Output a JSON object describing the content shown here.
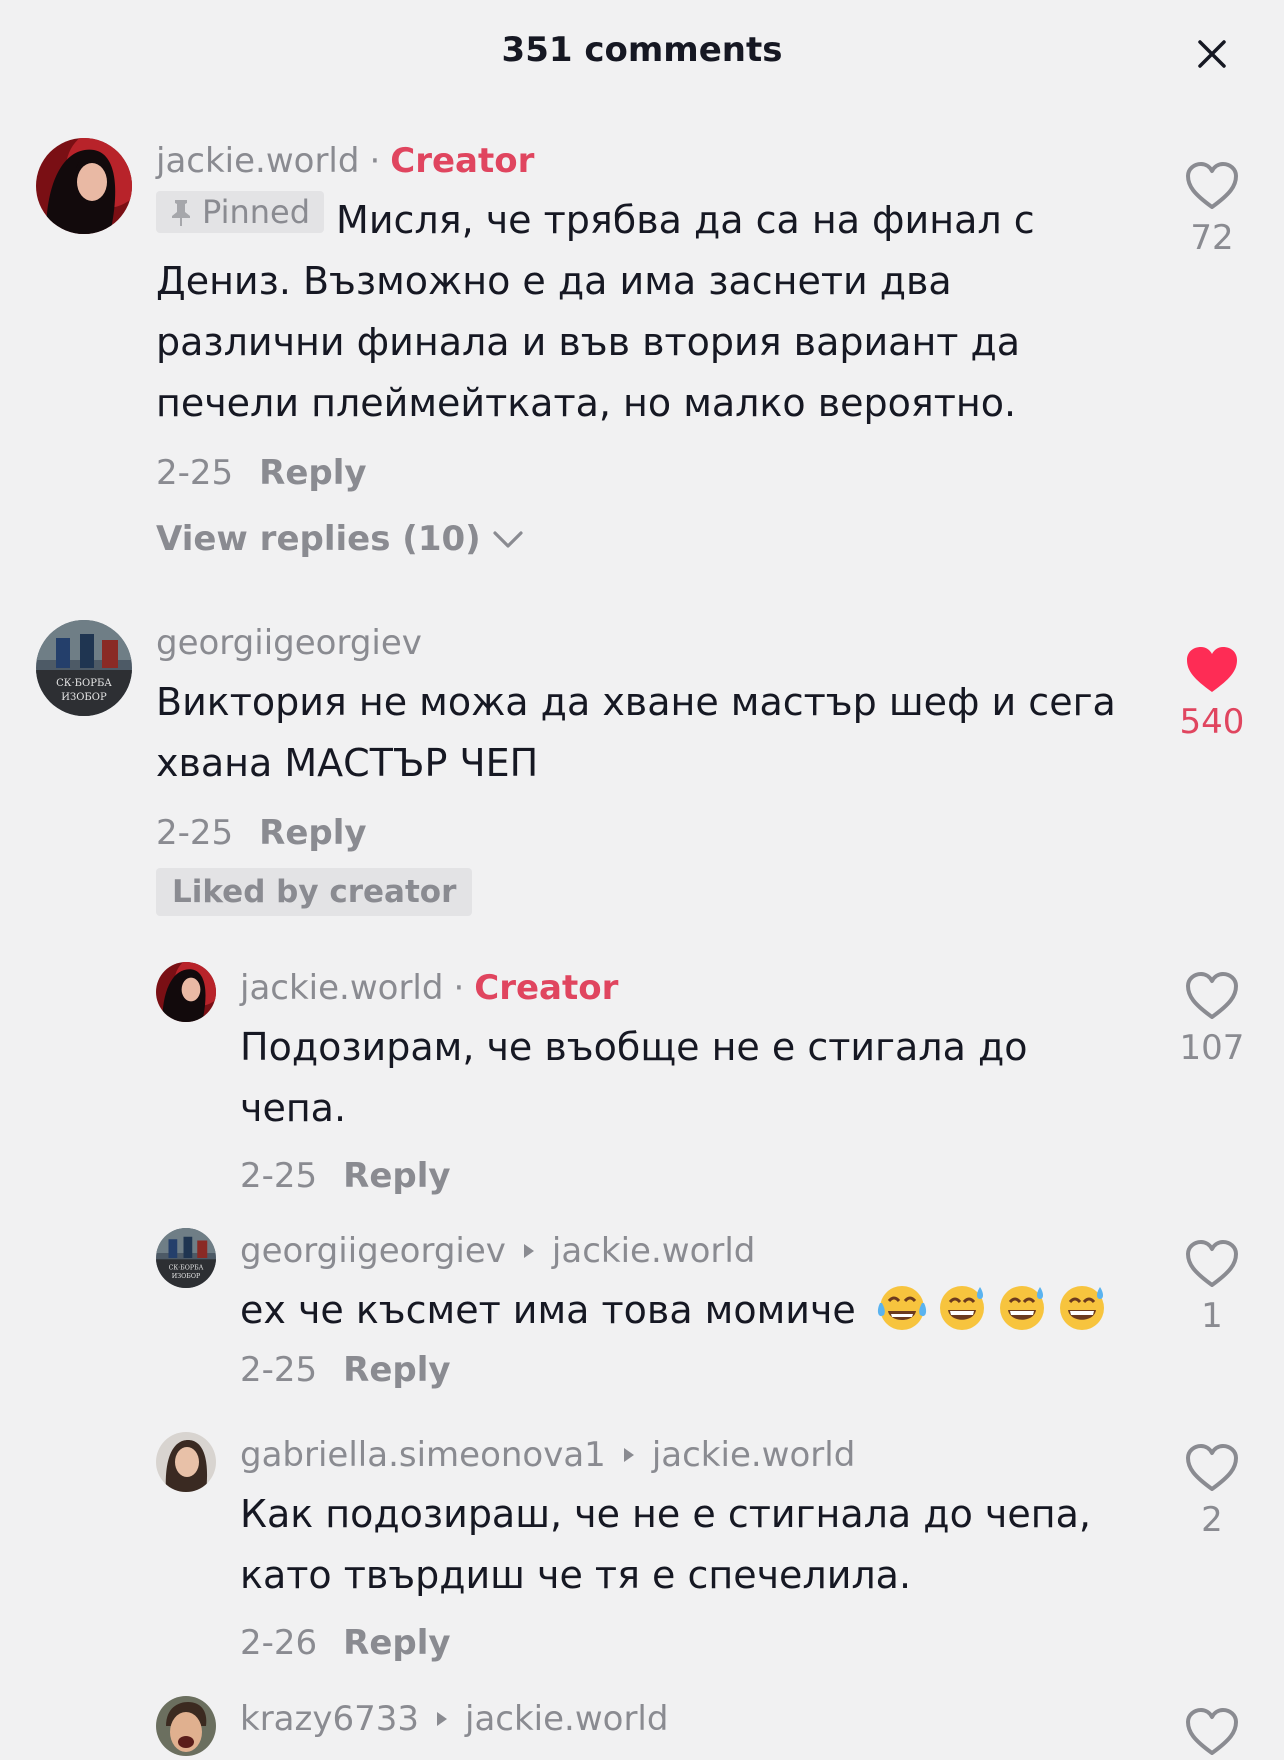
{
  "header": {
    "title": "351 comments"
  },
  "comments": [
    {
      "username": "jackie.world",
      "separator": "·",
      "creator_label": "Creator",
      "pinned_label": "Pinned",
      "text": "Мисля, че трябва да са на финал с Дениз. Възможно е да има заснети два различни финала и във втория вариант да печели плеймейтката, но малко вероятно.",
      "date": "2-25",
      "reply_label": "Reply",
      "view_replies_label": "View replies (10)",
      "likes": "72",
      "liked": false
    },
    {
      "username": "georgiigeorgiev",
      "text": "Виктория не можа да хване мастър шеф и сега хвана МАСТЪР ЧЕП",
      "date": "2-25",
      "reply_label": "Reply",
      "liked_by_creator_label": "Liked by creator",
      "likes": "540",
      "liked": true
    }
  ],
  "replies": [
    {
      "username": "jackie.world",
      "separator": "·",
      "creator_label": "Creator",
      "text": "Подозирам, че въобще не е стигала до чепа.",
      "date": "2-25",
      "reply_label": "Reply",
      "likes": "107"
    },
    {
      "username": "georgiigeorgiev",
      "reply_to": "jackie.world",
      "text": "ех че късмет има това момиче",
      "emojis": [
        "face-with-tears-of-joy",
        "grinning-sweat-face",
        "grinning-sweat-face",
        "grinning-sweat-face"
      ],
      "date": "2-25",
      "reply_label": "Reply",
      "likes": "1"
    },
    {
      "username": "gabriella.simeonova1",
      "reply_to": "jackie.world",
      "text": "Как подозираш, че не е стигнала до чепа, като твърдиш че тя е спечелила.",
      "date": "2-26",
      "reply_label": "Reply",
      "likes": "2"
    },
    {
      "username": "krazy6733",
      "reply_to": "jackie.world"
    }
  ],
  "colors": {
    "background": "#f1f1f2",
    "primary_text": "#161823",
    "secondary_text": "#8a8b91",
    "creator_accent": "#e0455f",
    "liked_heart": "#fe2c55"
  },
  "icons": {
    "close": "close-icon",
    "pin": "pin-icon",
    "heart": "heart-outline-icon",
    "heart_filled": "heart-filled-icon",
    "chevron": "chevron-down-icon",
    "reply_arrow": "reply-arrow-icon"
  }
}
